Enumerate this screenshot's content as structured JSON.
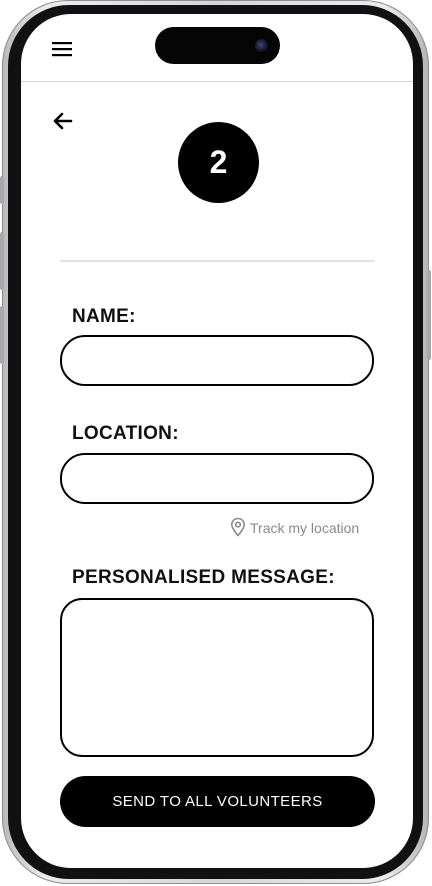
{
  "app": {
    "step_number": "2"
  },
  "icons": {
    "menu": "hamburger-menu-icon",
    "back": "arrow-left-icon",
    "location": "map-pin-icon"
  },
  "form": {
    "name_label": "NAME:",
    "name_value": "",
    "location_label": "LOCATION:",
    "location_value": "",
    "track_location_label": "Track my location",
    "message_label": "PERSONALISED MESSAGE:",
    "message_value": ""
  },
  "actions": {
    "send_label": "SEND TO ALL VOLUNTEERS"
  },
  "colors": {
    "primary": "#000000",
    "muted_text": "#8a8a8a",
    "divider": "#e3e3e3",
    "background": "#ffffff"
  }
}
